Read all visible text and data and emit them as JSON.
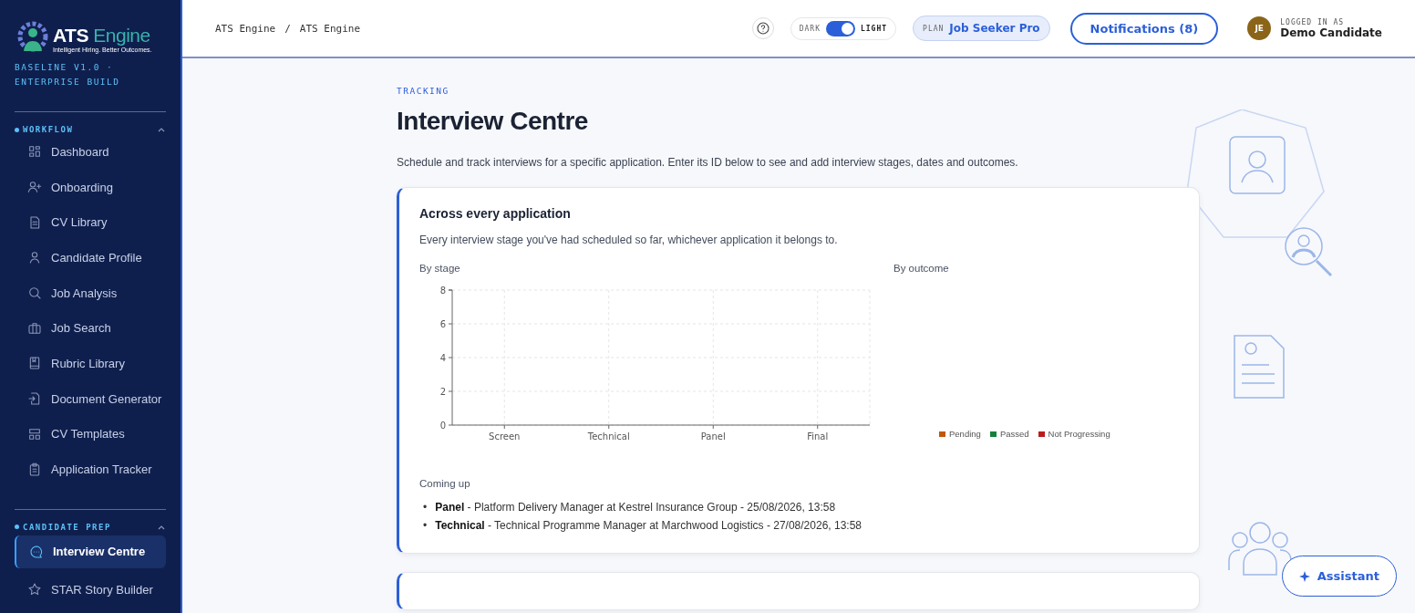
{
  "sidebar": {
    "logo": {
      "name": "ATS",
      "accent": "Engine",
      "tagline": "Intelligent Hiring. Better Outcomes."
    },
    "build": "BASELINE V1.0 · ENTERPRISE BUILD",
    "sections": [
      {
        "title": "WORKFLOW",
        "expanded": true,
        "items": [
          {
            "label": "Dashboard",
            "selected": false
          },
          {
            "label": "Onboarding",
            "selected": false
          },
          {
            "label": "CV Library",
            "selected": false
          },
          {
            "label": "Candidate Profile",
            "selected": false
          },
          {
            "label": "Job Analysis",
            "selected": false
          },
          {
            "label": "Job Search",
            "selected": false
          },
          {
            "label": "Rubric Library",
            "selected": false
          },
          {
            "label": "Document Generator",
            "selected": false
          },
          {
            "label": "CV Templates",
            "selected": false
          },
          {
            "label": "Application Tracker",
            "selected": false
          }
        ]
      },
      {
        "title": "CANDIDATE PREP",
        "expanded": true,
        "items": [
          {
            "label": "Interview Centre",
            "selected": true
          },
          {
            "label": "STAR Story Builder",
            "selected": false
          }
        ]
      }
    ]
  },
  "header": {
    "breadcrumbs": [
      "ATS Engine",
      "ATS Engine"
    ],
    "separator": "/",
    "theme_toggle": {
      "dark_label": "DARK",
      "light_label": "LIGHT",
      "on": true
    },
    "plan": {
      "label": "PLAN",
      "value": "Job Seeker Pro"
    },
    "notifications": "Notifications (8)",
    "user": {
      "initials": "JE",
      "caption": "LOGGED IN AS",
      "name": "Demo Candidate"
    }
  },
  "page": {
    "eyebrow": "TRACKING",
    "title": "Interview Centre",
    "description": "Schedule and track interviews for a specific application. Enter its ID below to see and add interview stages, dates and outcomes."
  },
  "summary_card": {
    "title": "Across every application",
    "subtitle": "Every interview stage you've had scheduled so far, whichever application it belongs to.",
    "stage_chart": {
      "title": "By stage",
      "chart_data": {
        "type": "bar",
        "categories": [
          "Screen",
          "Technical",
          "Panel",
          "Final"
        ],
        "values": [
          null,
          null,
          null,
          null
        ],
        "grid": true,
        "ylim": [
          0,
          8
        ],
        "yticks": [
          0,
          2,
          4,
          6,
          8
        ]
      }
    },
    "outcome_chart": {
      "title": "By outcome",
      "legend": [
        {
          "label": "Pending",
          "color": "#c2570c"
        },
        {
          "label": "Passed",
          "color": "#15803d"
        },
        {
          "label": "Not Progressing",
          "color": "#b91c1c"
        }
      ]
    },
    "coming_up": {
      "title": "Coming up",
      "marker": "•",
      "items": [
        "**Panel** - Platform Delivery Manager at Kestrel Insurance Group - 25/08/2026, 13:58",
        "**Technical** - Technical Programme Manager at Marchwood Logistics - 27/08/2026, 13:58"
      ]
    }
  },
  "assistant_button": "Assistant"
}
